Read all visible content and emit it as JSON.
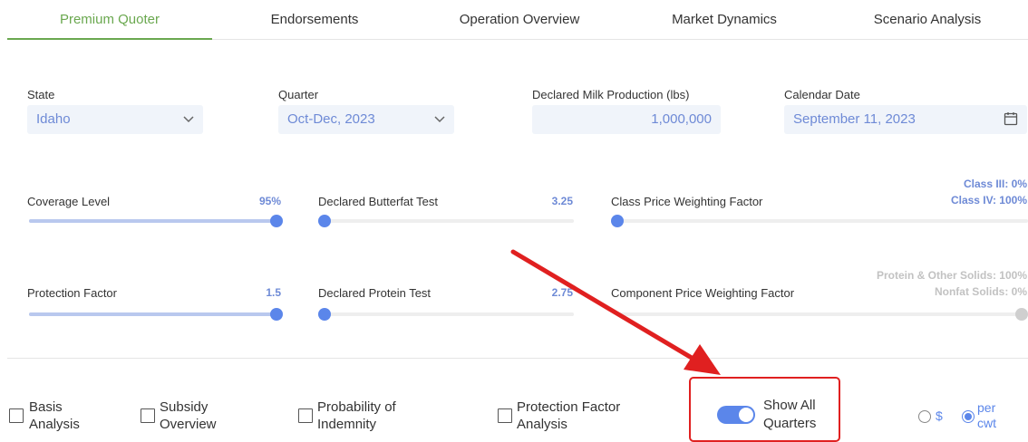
{
  "tabs": [
    {
      "label": "Premium Quoter",
      "active": true
    },
    {
      "label": "Endorsements",
      "active": false
    },
    {
      "label": "Operation Overview",
      "active": false
    },
    {
      "label": "Market Dynamics",
      "active": false
    },
    {
      "label": "Scenario Analysis",
      "active": false
    }
  ],
  "fields": {
    "state": {
      "label": "State",
      "value": "Idaho"
    },
    "quarter": {
      "label": "Quarter",
      "value": "Oct-Dec, 2023"
    },
    "production": {
      "label": "Declared Milk Production (lbs)",
      "value": "1,000,000"
    },
    "date": {
      "label": "Calendar Date",
      "value": "September 11, 2023"
    }
  },
  "sliders": {
    "coverage": {
      "label": "Coverage Level",
      "value": "95%",
      "position": 1.0
    },
    "butterfat": {
      "label": "Declared Butterfat Test",
      "value": "3.25",
      "position": 0.0
    },
    "class_price": {
      "label": "Class Price Weighting Factor",
      "value_line1": "Class III: 0%",
      "value_line2": "Class IV: 100%",
      "position": 0.0
    },
    "protection": {
      "label": "Protection Factor",
      "value": "1.5",
      "position": 1.0
    },
    "protein": {
      "label": "Declared Protein Test",
      "value": "2.75",
      "position": 0.0
    },
    "component": {
      "label": "Component Price Weighting Factor",
      "value_line1": "Protein & Other Solids: 100%",
      "value_line2": "Nonfat Solids: 0%",
      "position": 1.0
    }
  },
  "options": {
    "basis": {
      "line1": "Basis",
      "line2": "Analysis",
      "checked": false
    },
    "subsidy": {
      "line1": "Subsidy",
      "line2": "Overview",
      "checked": false
    },
    "probability": {
      "line1": "Probability of",
      "line2": "Indemnity",
      "checked": false
    },
    "protection_factor": {
      "line1": "Protection Factor",
      "line2": "Analysis",
      "checked": false
    },
    "show_all": {
      "line1": "Show All",
      "line2": "Quarters",
      "on": true
    }
  },
  "units": {
    "dollar": {
      "label": "$",
      "selected": false
    },
    "cwt": {
      "line1": "per",
      "line2": "cwt",
      "selected": true
    }
  },
  "colors": {
    "accent": "#5b86ea",
    "tab_active": "#6aa84f",
    "annotation": "#e02020"
  }
}
